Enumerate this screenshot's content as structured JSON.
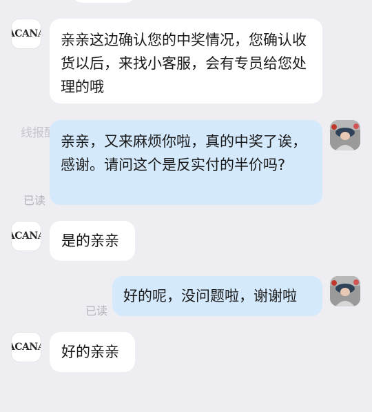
{
  "messages": [
    {
      "id": "m1",
      "side": "in",
      "text": "亲亲这边确认您的中奖情况，您确认收货以后，来找小客服，会有专员给您处理的哦"
    },
    {
      "id": "m2",
      "side": "out",
      "text": "亲亲，又来麻烦你啦，真的中奖了诶，感谢。请问这个是反实付的半价吗?",
      "status": "已读"
    },
    {
      "id": "m3",
      "side": "in",
      "text": "是的亲亲"
    },
    {
      "id": "m4",
      "side": "out",
      "text": "好的呢，没问题啦，谢谢啦",
      "status": "已读"
    },
    {
      "id": "m5",
      "side": "in",
      "text": "好的亲亲"
    }
  ],
  "brand_avatar_text": "ACANA",
  "watermark": "线报酷 new.xianbao.fun"
}
